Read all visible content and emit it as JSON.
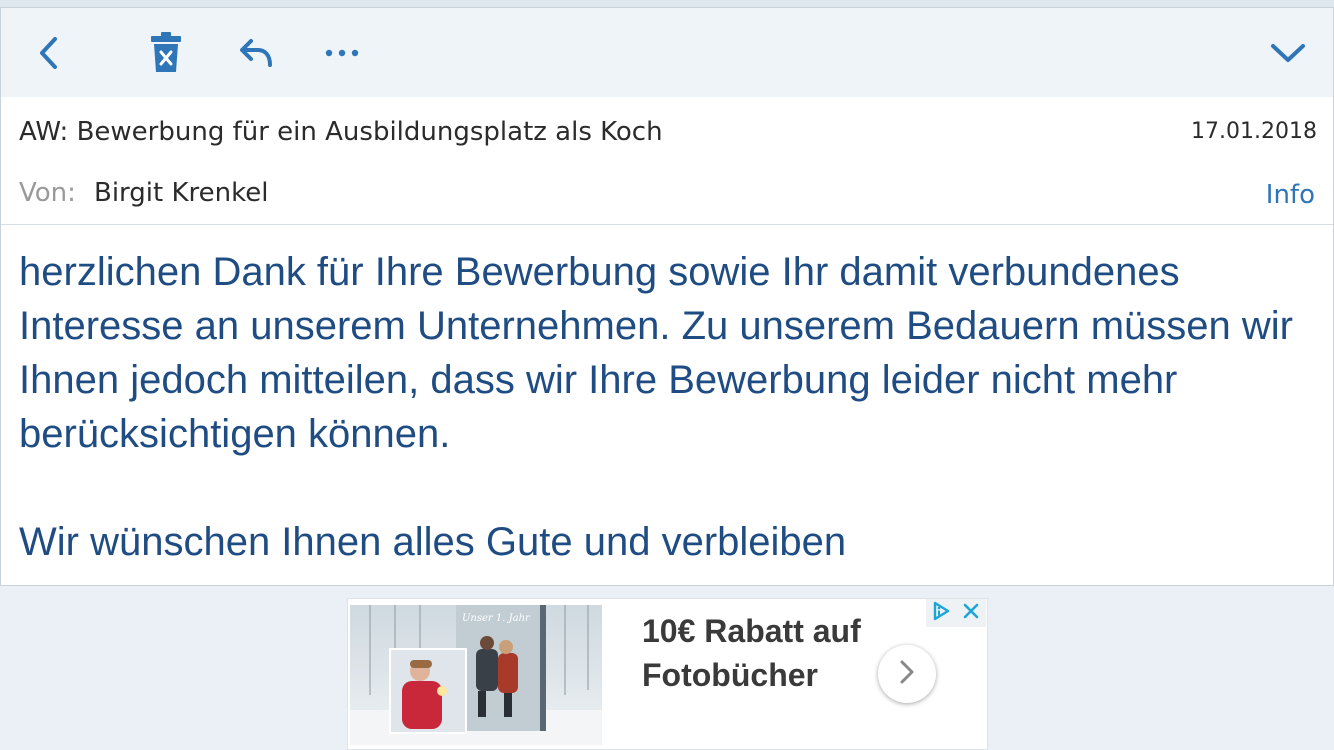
{
  "toolbar": {
    "icons": [
      "back-chevron-icon",
      "trash-icon",
      "reply-icon",
      "more-icon",
      "collapse-chevron-icon"
    ]
  },
  "email": {
    "subject": "AW: Bewerbung für ein Ausbildungsplatz als Koch",
    "date": "17.01.2018",
    "from_label": "Von:",
    "from_name": "Birgit Krenkel",
    "info_label": "Info",
    "body_paragraphs": [
      "herzlichen Dank für Ihre Bewerbung sowie Ihr damit verbundenes Interesse an unserem Unternehmen. Zu unserem Bedauern müssen wir Ihnen jedoch mitteilen, dass wir Ihre Bewerbung leider nicht mehr berücksichtigen können.",
      "Wir wünschen Ihnen alles Gute und verbleiben"
    ]
  },
  "ad": {
    "text": "10€ Rabatt auf Fotobücher",
    "book_text": "Unser 1. Jahr",
    "icons": [
      "adchoices-icon",
      "close-icon",
      "chevron-right-icon"
    ]
  },
  "colors": {
    "accent": "#2e76b8",
    "body_text": "#1f4c82",
    "toolbar_bg": "#eff4f8",
    "page_bg": "#eaf0f5"
  }
}
